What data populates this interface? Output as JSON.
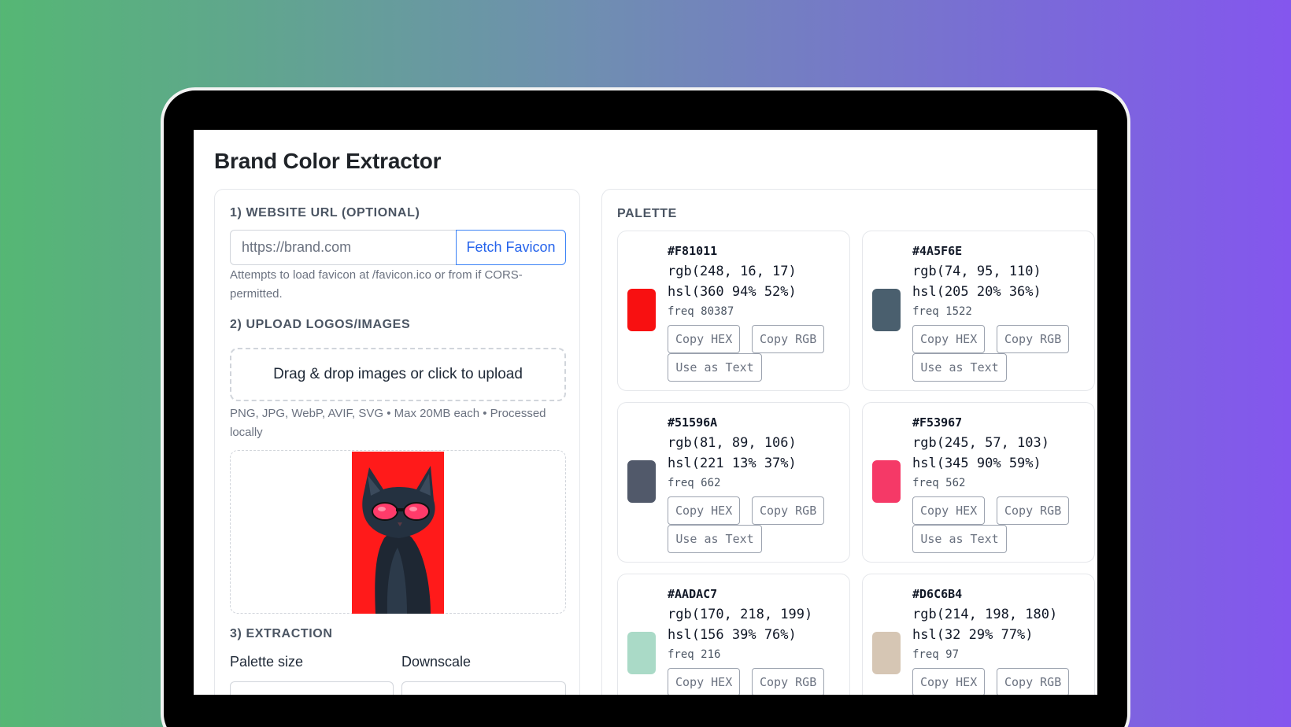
{
  "app": {
    "title": "Brand Color Extractor"
  },
  "section1": {
    "title": "1) WEBSITE URL (OPTIONAL)",
    "url_placeholder": "https://brand.com",
    "fetch_label": "Fetch Favicon",
    "hint": "Attempts to load favicon at /favicon.ico or from if CORS-permitted."
  },
  "section2": {
    "title": "2) UPLOAD LOGOS/IMAGES",
    "dropzone_label": "Drag & drop images or click to upload",
    "hint": "PNG, JPG, WebP, AVIF, SVG • Max 20MB each • Processed locally"
  },
  "section3": {
    "title": "3) EXTRACTION",
    "palette_size_label": "Palette size",
    "downscale_label": "Downscale"
  },
  "palette": {
    "title": "PALETTE",
    "copy_hex_label": "Copy HEX",
    "copy_rgb_label": "Copy RGB",
    "use_text_label": "Use as Text",
    "colors": [
      {
        "hex": "#F81011",
        "rgb": "rgb(248, 16, 17)",
        "hsl": "hsl(360 94% 52%)",
        "freq": "freq 80387"
      },
      {
        "hex": "#4A5F6E",
        "rgb": "rgb(74, 95, 110)",
        "hsl": "hsl(205 20% 36%)",
        "freq": "freq 1522"
      },
      {
        "hex": "#51596A",
        "rgb": "rgb(81, 89, 106)",
        "hsl": "hsl(221 13% 37%)",
        "freq": "freq 662"
      },
      {
        "hex": "#F53967",
        "rgb": "rgb(245, 57, 103)",
        "hsl": "hsl(345 90% 59%)",
        "freq": "freq 562"
      },
      {
        "hex": "#AADAC7",
        "rgb": "rgb(170, 218, 199)",
        "hsl": "hsl(156 39% 76%)",
        "freq": "freq 216"
      },
      {
        "hex": "#D6C6B4",
        "rgb": "rgb(214, 198, 180)",
        "hsl": "hsl(32 29% 77%)",
        "freq": "freq 97"
      }
    ]
  }
}
